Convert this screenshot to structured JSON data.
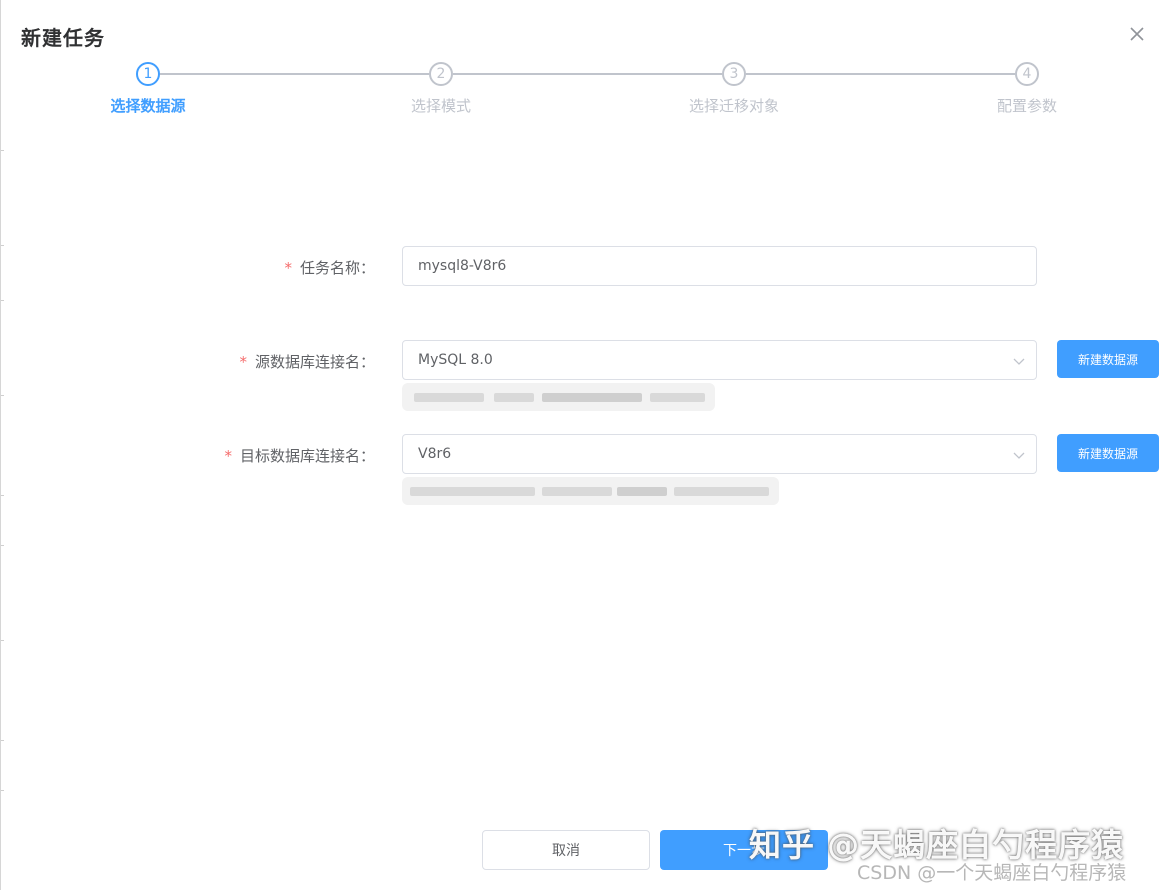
{
  "dialog": {
    "title": "新建任务",
    "close_icon": "close-icon"
  },
  "steps": [
    {
      "number": "1",
      "label": "选择数据源",
      "state": "active"
    },
    {
      "number": "2",
      "label": "选择模式",
      "state": "pending"
    },
    {
      "number": "3",
      "label": "选择迁移对象",
      "state": "pending"
    },
    {
      "number": "4",
      "label": "配置参数",
      "state": "pending"
    }
  ],
  "form": {
    "task_name": {
      "required_mark": "*",
      "label": "任务名称：",
      "value": "mysql8-V8r6"
    },
    "source_connection": {
      "required_mark": "*",
      "label": "源数据库连接名：",
      "value": "MySQL 8.0",
      "new_button": "新建数据源",
      "arrow_icon": "chevron-down-icon"
    },
    "target_connection": {
      "required_mark": "*",
      "label": "目标数据库连接名：",
      "value": "V8r6",
      "new_button": "新建数据源",
      "arrow_icon": "chevron-down-icon"
    }
  },
  "footer": {
    "cancel_label": "取消",
    "next_label": "下一步"
  },
  "watermarks": {
    "zhihu": "知乎 @天蝎座白勺程序猿",
    "csdn": "CSDN @一个天蝎座白勺程序猿"
  },
  "colors": {
    "primary": "#409eff",
    "required": "#f56c6c",
    "inactive": "#c0c4cc"
  }
}
